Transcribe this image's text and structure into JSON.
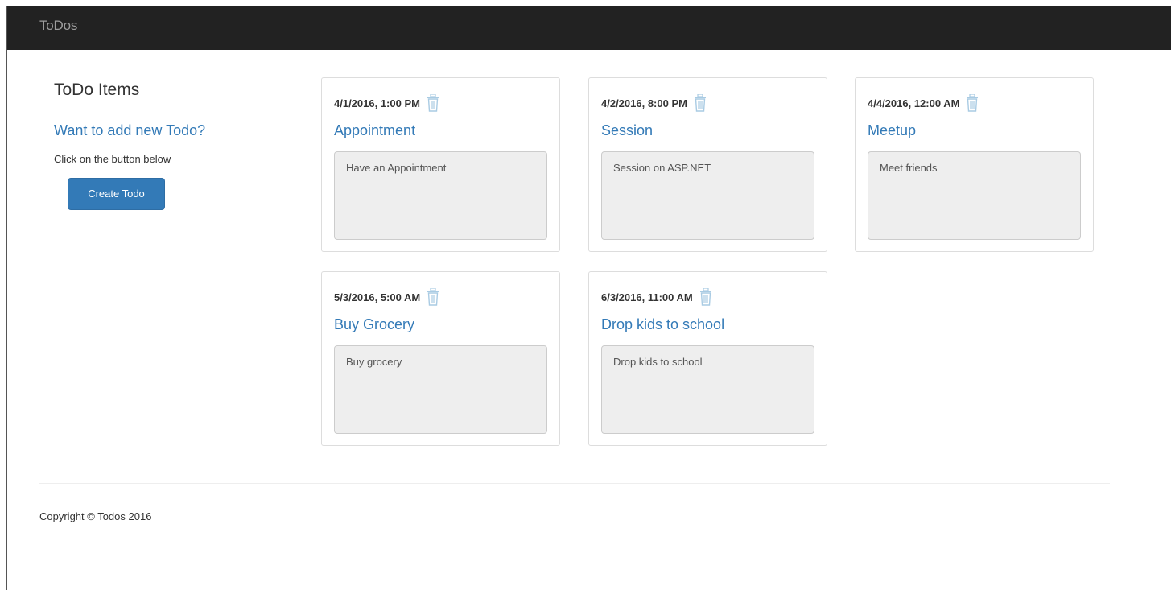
{
  "navbar": {
    "brand": "ToDos"
  },
  "sidebar": {
    "title": "ToDo Items",
    "subtitle": "Want to add new Todo?",
    "hint": "Click on the button below",
    "create_label": "Create Todo"
  },
  "todos": [
    {
      "date": "4/1/2016, 1:00 PM",
      "title": "Appointment",
      "description": "Have an Appointment"
    },
    {
      "date": "4/2/2016, 8:00 PM",
      "title": "Session",
      "description": "Session on ASP.NET"
    },
    {
      "date": "4/4/2016, 12:00 AM",
      "title": "Meetup",
      "description": "Meet friends"
    },
    {
      "date": "5/3/2016, 5:00 AM",
      "title": "Buy Grocery",
      "description": "Buy grocery"
    },
    {
      "date": "6/3/2016, 11:00 AM",
      "title": "Drop kids to school",
      "description": "Drop kids to school"
    }
  ],
  "footer": {
    "copyright": "Copyright © Todos 2016"
  },
  "icons": {
    "delete": "trash-icon"
  },
  "colors": {
    "navbar": "#222222",
    "link": "#337ab7",
    "button": "#337ab7",
    "icon": "#a9cbe3"
  }
}
